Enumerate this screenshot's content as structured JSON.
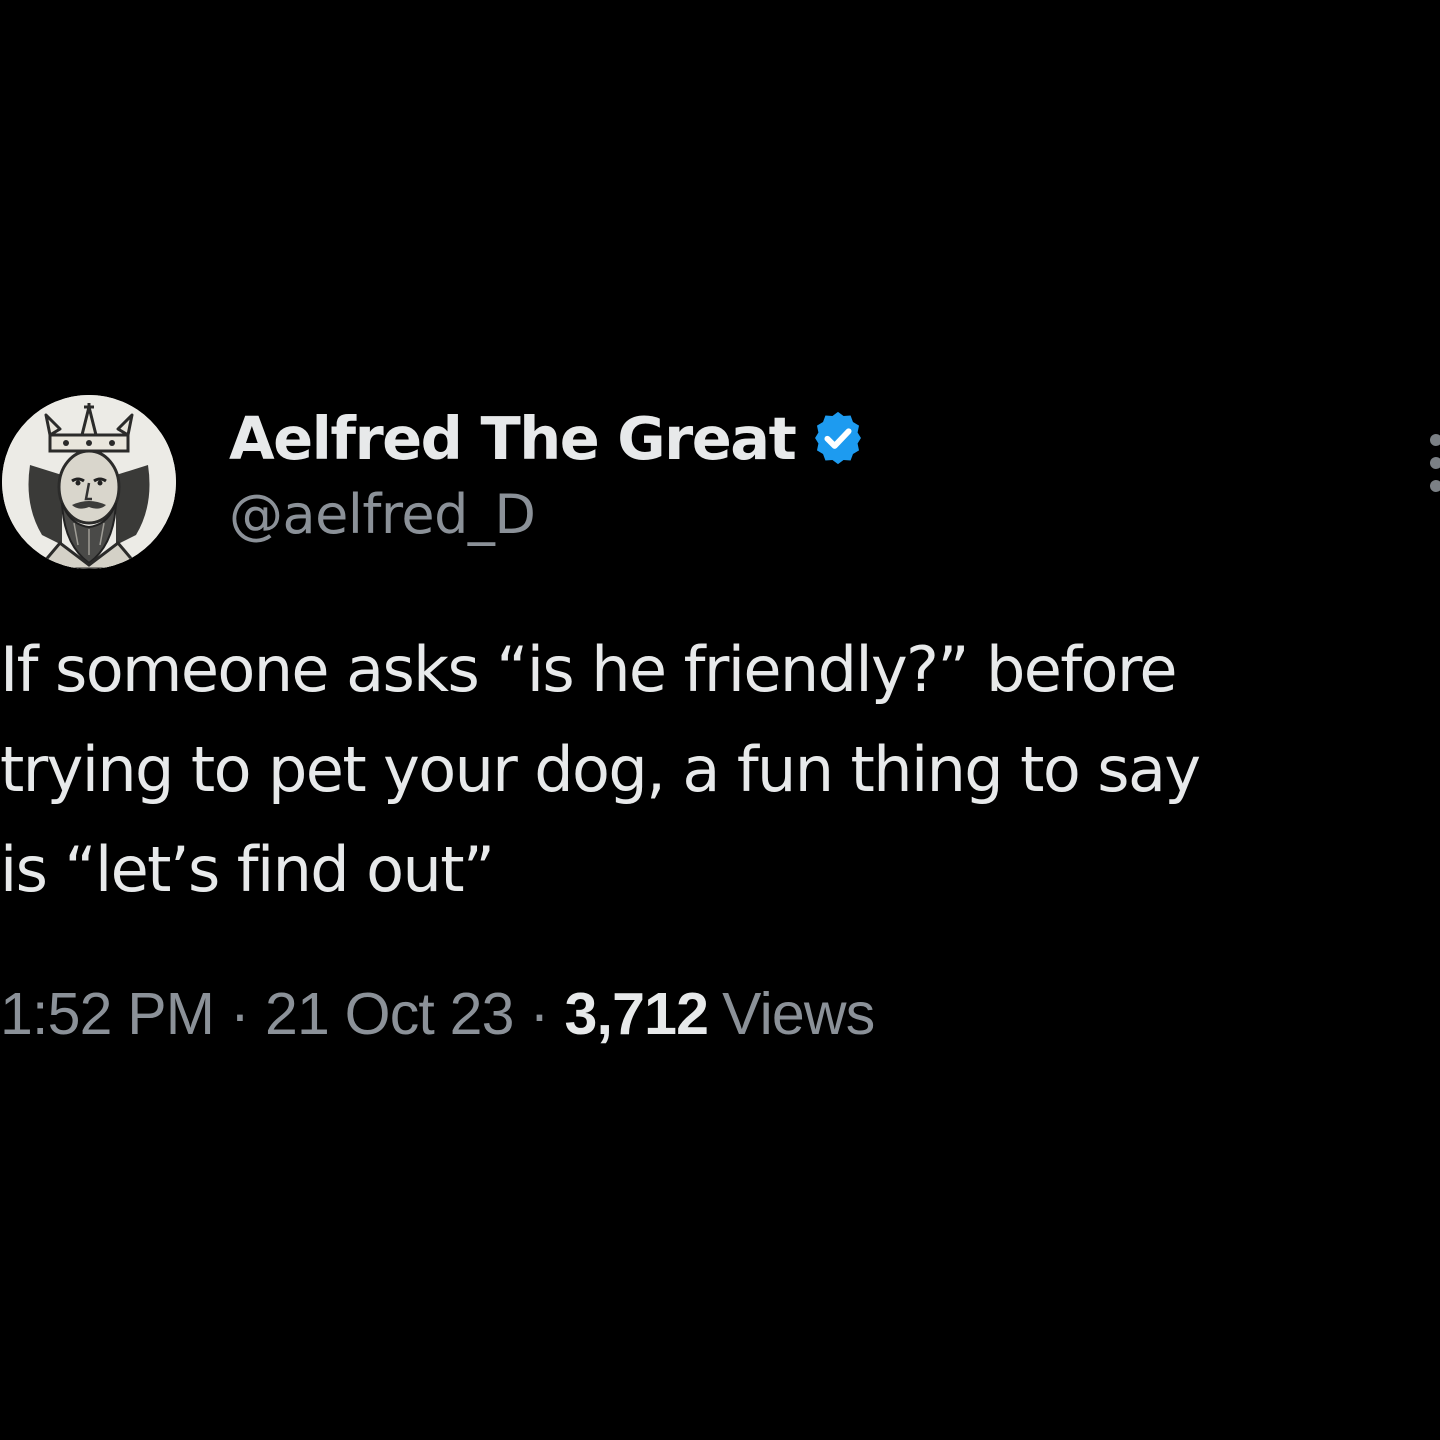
{
  "author": {
    "display_name": "Aelfred The Great",
    "handle": "@aelfred_D",
    "verified_color": "#1d9bf0",
    "avatar_icon": "king-portrait-icon"
  },
  "tweet": {
    "lines": [
      "If someone asks “is he friendly?” before",
      "trying to pet your dog, a fun thing to say",
      "is “let’s find out”"
    ]
  },
  "meta": {
    "time": "1:52 PM",
    "separator": "·",
    "date": "21 Oct 23",
    "views_count": "3,712",
    "views_label": "Views"
  },
  "colors": {
    "background": "#000000",
    "primary_text": "#e7e9ea",
    "secondary_text": "#8b9198"
  }
}
